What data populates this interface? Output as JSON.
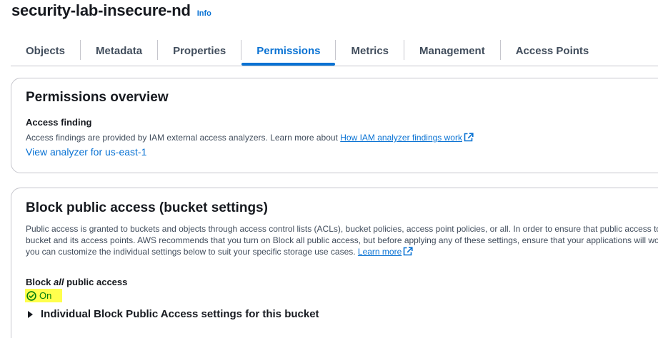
{
  "header": {
    "bucket_name": "security-lab-insecure-nd",
    "info_label": "Info"
  },
  "tabs": [
    {
      "label": "Objects",
      "active": false
    },
    {
      "label": "Metadata",
      "active": false
    },
    {
      "label": "Properties",
      "active": false
    },
    {
      "label": "Permissions",
      "active": true
    },
    {
      "label": "Metrics",
      "active": false
    },
    {
      "label": "Management",
      "active": false
    },
    {
      "label": "Access Points",
      "active": false
    }
  ],
  "permissions_overview": {
    "title": "Permissions overview",
    "access_finding_label": "Access finding",
    "access_finding_desc": "Access findings are provided by IAM external access analyzers. Learn more about ",
    "analyzer_link": "How IAM analyzer findings work",
    "view_analyzer_link": "View analyzer for us-east-1"
  },
  "block_public_access": {
    "title": "Block public access (bucket settings)",
    "desc_line1": "Public access is granted to buckets and objects through access control lists (ACLs), bucket policies, access point policies, or all. In order to ensure that public access to this",
    "desc_line2": "bucket and its access points. AWS recommends that you turn on Block all public access, but before applying any of these settings, ensure that your applications will work correctly",
    "desc_line3": "you can customize the individual settings below to suit your specific storage use cases. ",
    "learn_more_link": "Learn more",
    "block_all_prefix": "Block ",
    "block_all_em": "all",
    "block_all_suffix": " public access",
    "status_text": "On",
    "status_icon": "check-circle-icon",
    "individual_settings_label": "Individual Block Public Access settings for this bucket"
  },
  "colors": {
    "link": "#0972d3",
    "success": "#037f0c",
    "highlight": "#ffff4d"
  }
}
